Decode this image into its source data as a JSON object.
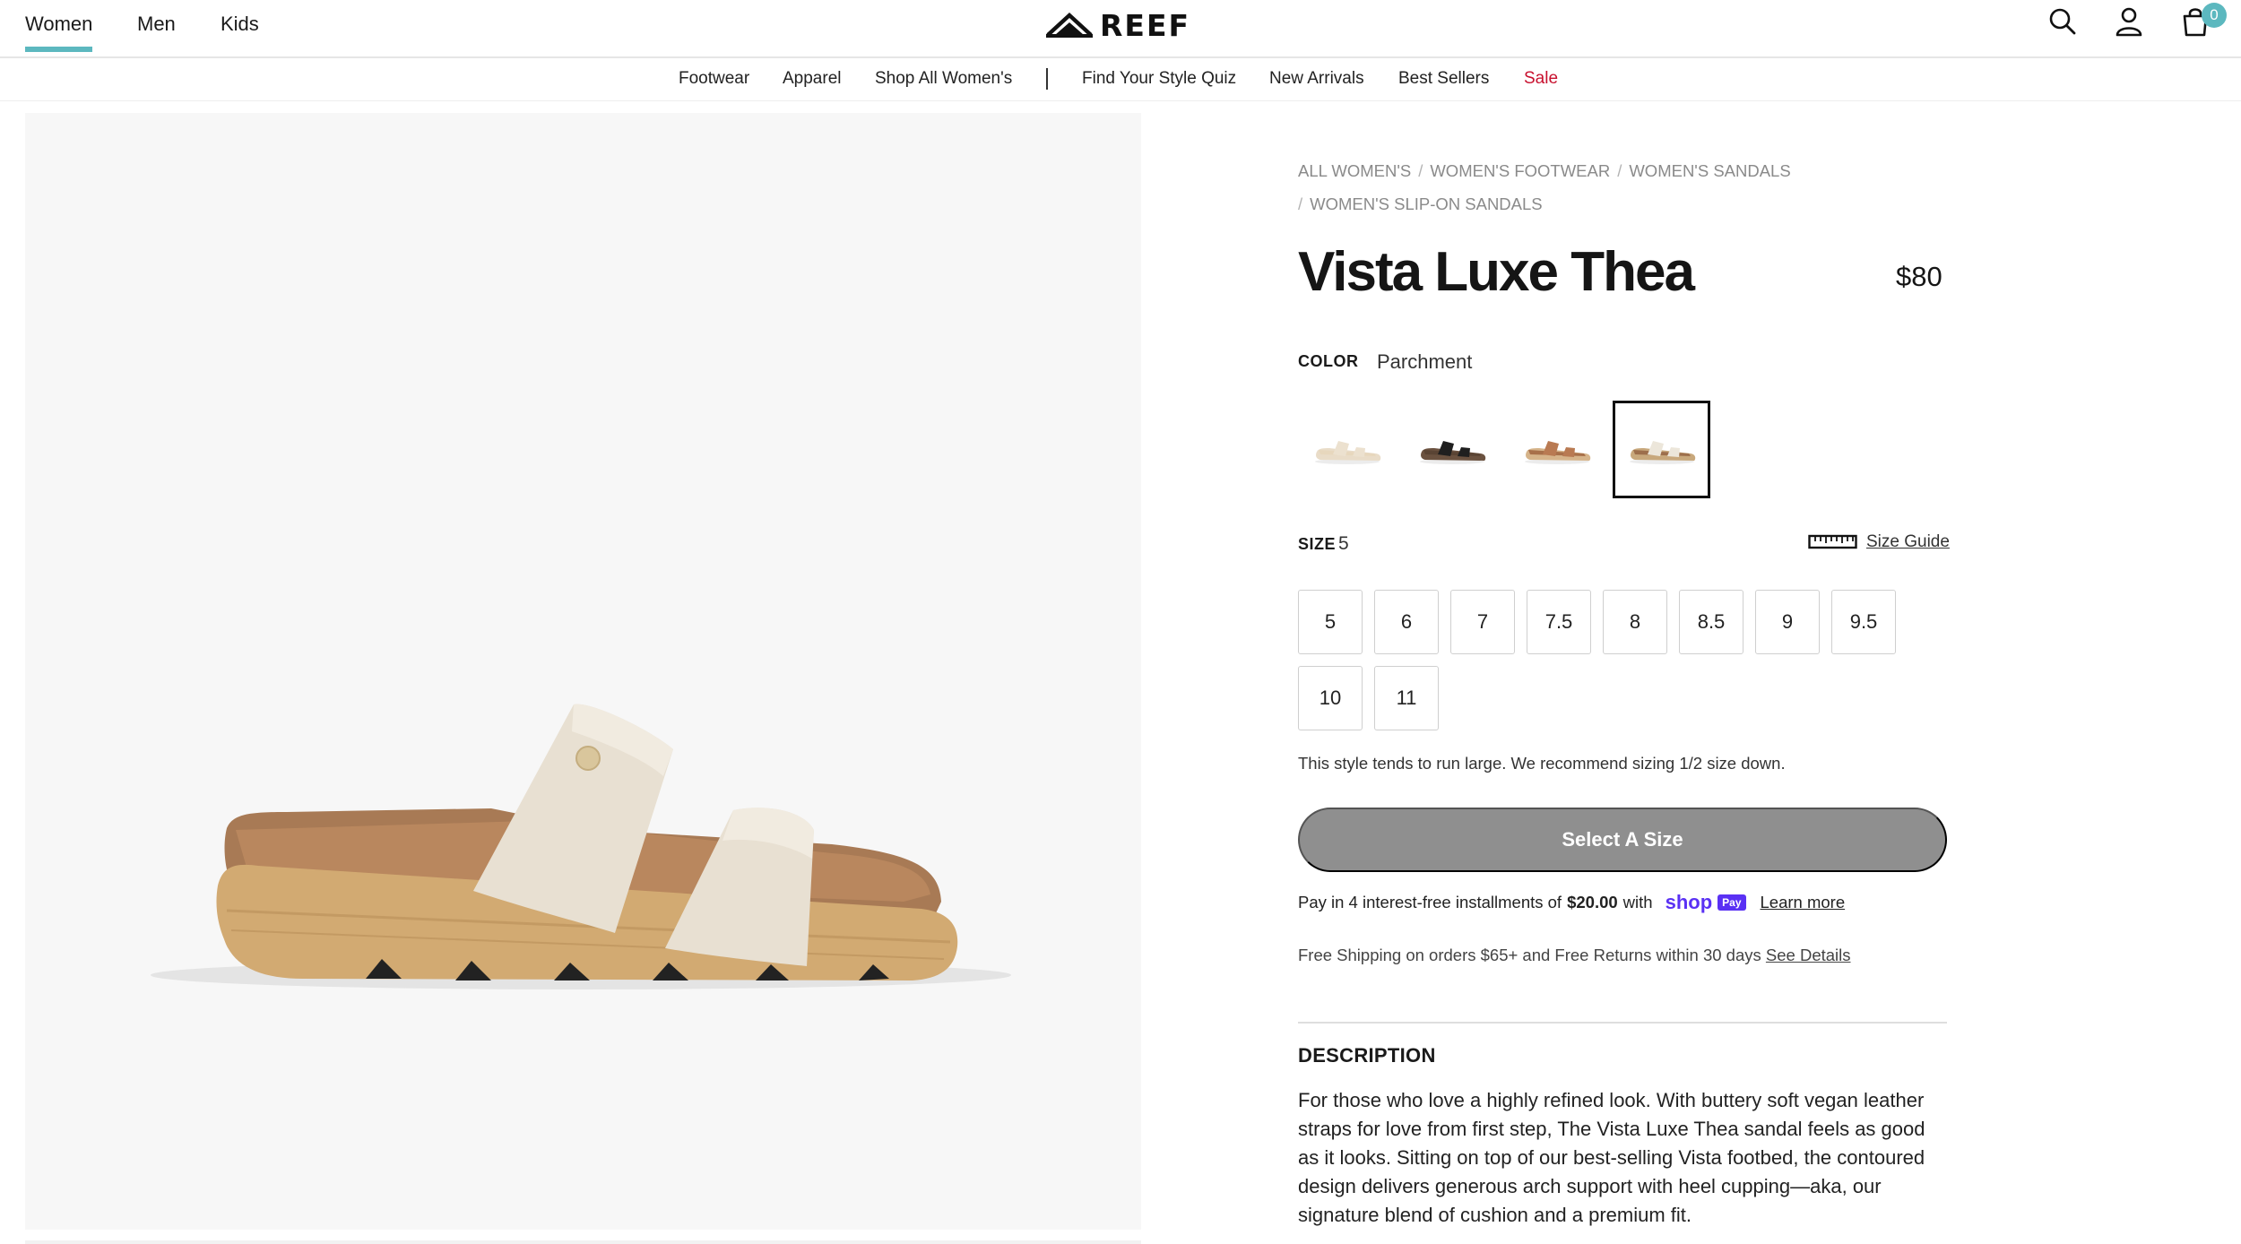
{
  "header": {
    "tabs": [
      {
        "label": "Women",
        "active": true
      },
      {
        "label": "Men",
        "active": false
      },
      {
        "label": "Kids",
        "active": false
      }
    ],
    "logo_text": "REEF",
    "icons": [
      "search-icon",
      "account-icon",
      "cart-icon"
    ],
    "cart_count": "0",
    "accent_color": "#5cb8bf"
  },
  "subnav": {
    "items": [
      "Footwear",
      "Apparel",
      "Shop All Women's",
      "Find Your Style Quiz",
      "New Arrivals",
      "Best Sellers"
    ],
    "sale_label": "Sale",
    "sale_color": "#c8102e"
  },
  "breadcrumbs": [
    "ALL WOMEN'S",
    "WOMEN'S FOOTWEAR",
    "WOMEN'S SANDALS",
    "WOMEN'S SLIP-ON SANDALS"
  ],
  "product": {
    "title": "Vista Luxe Thea",
    "price": "$80",
    "color_label": "COLOR",
    "color_value": "Parchment",
    "swatches": [
      {
        "name": "swatch-1",
        "strap": "#ece1cf",
        "bed": "#e7d7bd",
        "sole": "#e9dcc8"
      },
      {
        "name": "swatch-2",
        "strap": "#1f1f1f",
        "bed": "#5a4434",
        "sole": "#6b5240"
      },
      {
        "name": "swatch-3",
        "strap": "#b97a52",
        "bed": "#a8704a",
        "sole": "#d6b48a"
      },
      {
        "name": "swatch-4",
        "strap": "#ece6da",
        "bed": "#9d6f4c",
        "sole": "#c8a87c",
        "selected": true
      }
    ],
    "size_label": "SIZE",
    "size_value": "5",
    "size_guide_label": "Size Guide",
    "sizes": [
      "5",
      "6",
      "7",
      "7.5",
      "8",
      "8.5",
      "9",
      "9.5",
      "10",
      "11"
    ],
    "fit_note": "This style tends to run large. We recommend sizing 1/2 size down.",
    "cta_label": "Select A Size",
    "installments": {
      "prefix": "Pay in 4 interest-free installments of",
      "amount": "$20.00",
      "suffix": "with",
      "brand": "shop",
      "brand_pill": "Pay",
      "link": "Learn more"
    },
    "shipping": {
      "text": "Free Shipping on orders $65+ and Free Returns within 30 days",
      "link": "See Details"
    },
    "description_heading": "DESCRIPTION",
    "description": "For those who love a highly refined look. With buttery soft vegan leather straps for love from first step, The Vista Luxe Thea sandal feels as good as it looks. Sitting on top of our best-selling Vista footbed, the contoured design delivers generous arch support with heel cupping—aka, our signature blend of cushion and a premium fit."
  }
}
